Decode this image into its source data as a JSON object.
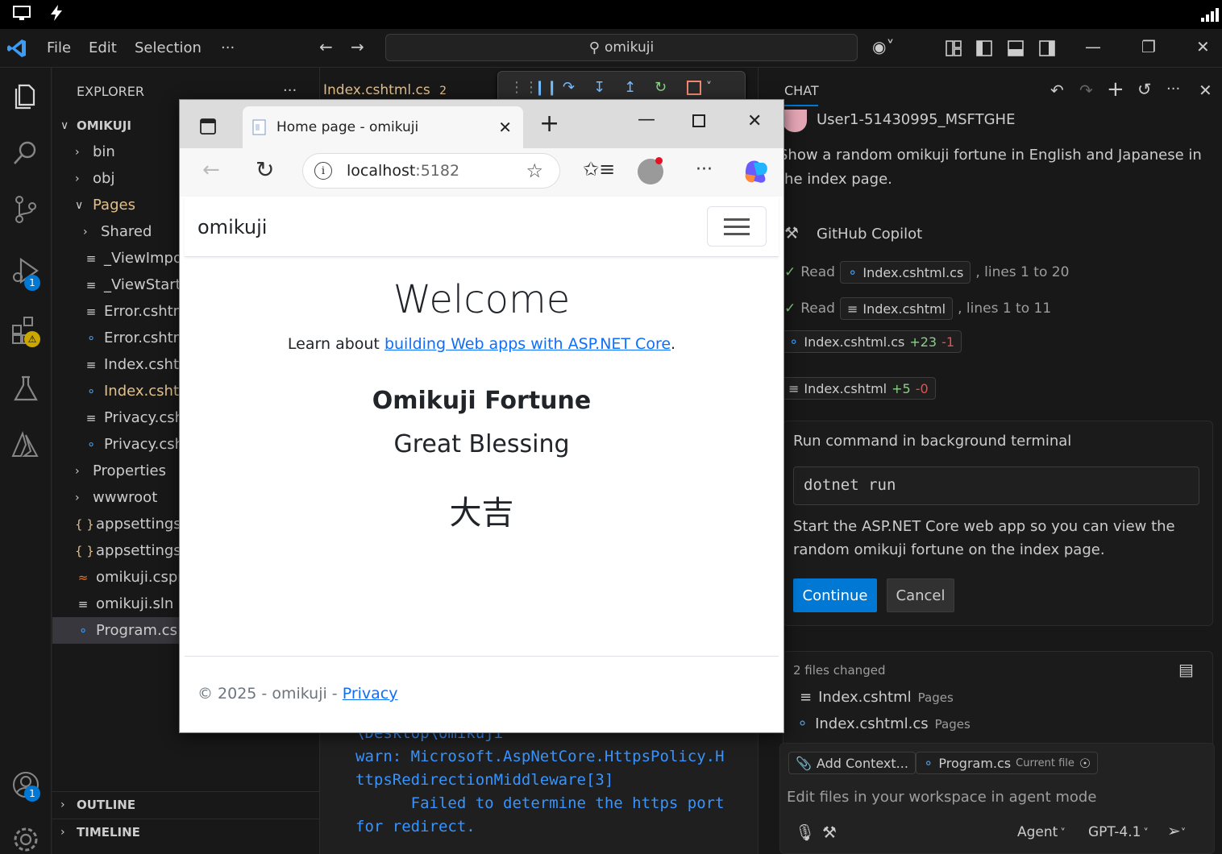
{
  "os": {
    "icons": [
      "monitor-icon",
      "bolt-icon",
      "signal-icon"
    ]
  },
  "titlebar": {
    "menu": [
      "File",
      "Edit",
      "Selection",
      "···"
    ],
    "search": "omikuji"
  },
  "activity": {
    "debug_badge": "1",
    "accounts_badge": "1",
    "warning_badge": "⚠"
  },
  "explorer": {
    "title": "EXPLORER",
    "more": "···",
    "root": "OMIKUJI",
    "items": [
      {
        "label": "bin",
        "type": "folder",
        "indent": 1,
        "color": "#cccccc"
      },
      {
        "label": "obj",
        "type": "folder",
        "indent": 1,
        "color": "#cccccc"
      },
      {
        "label": "Pages",
        "type": "folder-open",
        "indent": 1,
        "color": "#e2c08d"
      },
      {
        "label": "Shared",
        "type": "folder",
        "indent": 2,
        "color": "#cccccc"
      },
      {
        "label": "_ViewImpo",
        "type": "razor",
        "indent": 2,
        "color": "#cccccc"
      },
      {
        "label": "_ViewStart.",
        "type": "razor",
        "indent": 2,
        "color": "#cccccc"
      },
      {
        "label": "Error.cshtm",
        "type": "razor",
        "indent": 2,
        "color": "#cccccc"
      },
      {
        "label": "Error.cshtm",
        "type": "cs",
        "indent": 2,
        "color": "#cccccc"
      },
      {
        "label": "Index.cshtn",
        "type": "razor",
        "indent": 2,
        "color": "#cccccc"
      },
      {
        "label": "Index.cshtn",
        "type": "cs",
        "indent": 2,
        "color": "#e2c08d"
      },
      {
        "label": "Privacy.csh",
        "type": "razor",
        "indent": 2,
        "color": "#cccccc"
      },
      {
        "label": "Privacy.csh",
        "type": "cs",
        "indent": 2,
        "color": "#cccccc"
      },
      {
        "label": "Properties",
        "type": "folder",
        "indent": 1,
        "color": "#cccccc"
      },
      {
        "label": "wwwroot",
        "type": "folder",
        "indent": 1,
        "color": "#cccccc"
      },
      {
        "label": "appsettings.",
        "type": "json",
        "indent": 1,
        "color": "#cccccc"
      },
      {
        "label": "appsettings.",
        "type": "json",
        "indent": 1,
        "color": "#cccccc"
      },
      {
        "label": "omikuji.cspr",
        "type": "rss",
        "indent": 1,
        "color": "#cccccc"
      },
      {
        "label": "omikuji.sln",
        "type": "razor",
        "indent": 1,
        "color": "#cccccc"
      },
      {
        "label": "Program.cs",
        "type": "cs",
        "indent": 1,
        "color": "#cccccc",
        "selected": true
      }
    ],
    "outline": "OUTLINE",
    "timeline": "TIMELINE"
  },
  "editor": {
    "tab_label": "Index.cshtml.cs",
    "tab_count": "2",
    "terminal": [
      "\\Desktop\\omikuji",
      "warn: Microsoft.AspNetCore.HttpsPolicy.H",
      "ttpsRedirectionMiddleware[3]",
      "      Failed to determine the https port",
      "for redirect."
    ]
  },
  "browser": {
    "tab_title": "Home page - omikuji",
    "url_host": "localhost",
    "url_port": ":5182",
    "brand": "omikuji",
    "welcome": "Welcome",
    "learn_prefix": "Learn about ",
    "learn_link": "building Web apps with ASP.NET Core",
    "learn_suffix": ".",
    "fortune_title": "Omikuji Fortune",
    "fortune_en": "Great Blessing",
    "fortune_jp": "大吉",
    "footer_prefix": "© 2025 - omikuji - ",
    "footer_link": "Privacy"
  },
  "chat": {
    "title": "CHAT",
    "user": "User1-51430995_MSFTGHE",
    "prompt_line1": "Show a random omikuji fortune in English and Japanese in",
    "prompt_line2": "the index page.",
    "assistant": "GitHub Copilot",
    "read1_prefix": "Read",
    "read1_file": "Index.cshtml.cs",
    "read1_suffix": ", lines 1 to 20",
    "read2_prefix": "Read",
    "read2_file": "Index.cshtml",
    "read2_suffix": ", lines 1 to 11",
    "edit1_file": "Index.cshtml.cs",
    "edit1_add": "+23",
    "edit1_del": "-1",
    "edit2_file": "Index.cshtml",
    "edit2_add": "+5",
    "edit2_del": "-0",
    "run_title": "Run command in background terminal",
    "command": "dotnet run",
    "run_desc1": "Start the ASP.NET Core web app so you can view the",
    "run_desc2": "random omikuji fortune on the index page.",
    "continue": "Continue",
    "cancel": "Cancel",
    "files_changed": "2 files changed",
    "changed": [
      {
        "name": "Index.cshtml",
        "dir": "Pages",
        "type": "razor"
      },
      {
        "name": "Index.cshtml.cs",
        "dir": "Pages",
        "type": "cs"
      }
    ],
    "add_context": "Add Context...",
    "current_file": "Program.cs",
    "current_file_tag": "Current file",
    "input_placeholder": "Edit files in your workspace in agent mode",
    "mode": "Agent",
    "model": "GPT-4.1"
  }
}
